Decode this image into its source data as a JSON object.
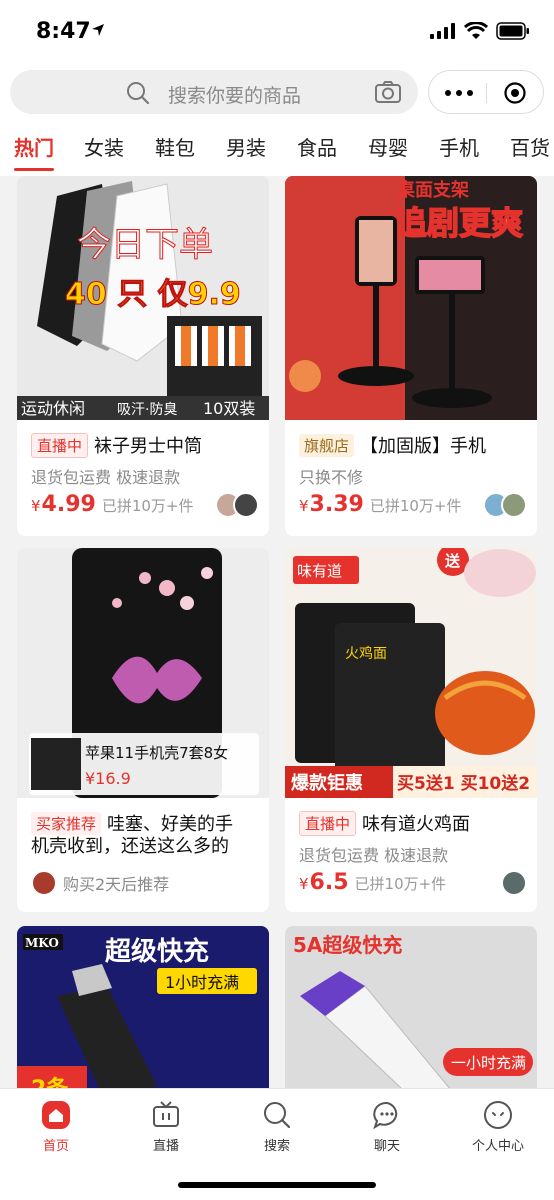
{
  "status": {
    "time": "8:47"
  },
  "search": {
    "placeholder": "搜索你要的商品"
  },
  "tabs": [
    "热门",
    "女装",
    "鞋包",
    "男装",
    "食品",
    "母婴",
    "手机",
    "百货"
  ],
  "products": [
    {
      "image_text": [
        "今日下单",
        "40 只 仅9.9",
        "运动休闲",
        "吸汗·防臭",
        "10双装"
      ],
      "tag": "直播中",
      "title": "袜子男士中筒",
      "subtitle": "退货包运费  极速退款",
      "price_symbol": "¥",
      "price": "4.99",
      "sold": "已拼10万+件"
    },
    {
      "image_text": [
        "桌面支架",
        "追剧更爽"
      ],
      "tag": "旗舰店",
      "title": "【加固版】手机",
      "subtitle": "只换不修",
      "price_symbol": "¥",
      "price": "3.39",
      "sold": "已拼10万+件"
    },
    {
      "overlay_title": "苹果11手机壳7套8女",
      "overlay_price": "¥16.9",
      "tag": "买家推荐",
      "title": "哇塞、好美的手",
      "title_line2": "机壳收到，还送这么多的",
      "recommend": "购买2天后推荐"
    },
    {
      "image_text": [
        "味有道",
        "送",
        "火鸡面",
        "爆款钜惠",
        "买5送1 买10送2"
      ],
      "tag": "直播中",
      "title": "味有道火鸡面",
      "subtitle": "退货包运费  极速退款",
      "price_symbol": "¥",
      "price": "6.5",
      "sold": "已拼10万+件"
    },
    {
      "image_text": [
        "MKO",
        "超级快充",
        "1小时充满",
        "2条"
      ]
    },
    {
      "image_text": [
        "5A超级快充",
        "一小时充满"
      ]
    }
  ],
  "tabbar": [
    {
      "label": "首页",
      "icon": "home-icon"
    },
    {
      "label": "直播",
      "icon": "tv-icon"
    },
    {
      "label": "搜索",
      "icon": "search-icon"
    },
    {
      "label": "聊天",
      "icon": "chat-icon"
    },
    {
      "label": "个人中心",
      "icon": "profile-icon"
    }
  ],
  "colors": {
    "accent": "#e5322d",
    "background": "#f2f2f2"
  }
}
